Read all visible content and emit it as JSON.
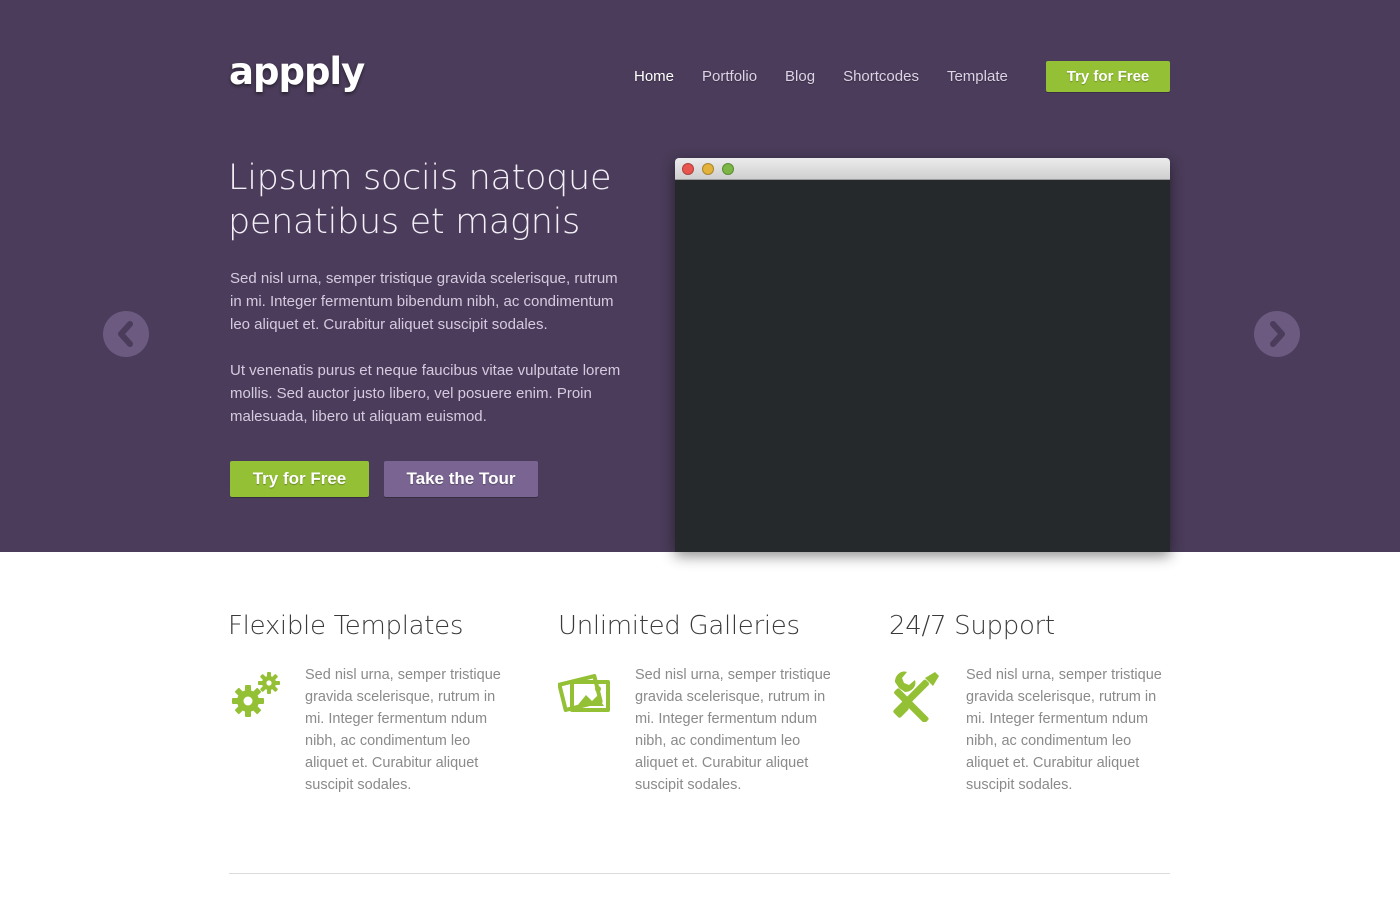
{
  "brand": {
    "logo": "appply"
  },
  "nav": {
    "items": [
      "Home",
      "Portfolio",
      "Blog",
      "Shortcodes",
      "Template"
    ],
    "cta": "Try for Free"
  },
  "hero": {
    "headline": "Lipsum sociis natoque penatibus et magnis",
    "paragraphs": [
      "Sed nisl urna, semper tristique gravida scelerisque, rutrum in mi. Integer fermentum bibendum nibh, ac condimentum leo aliquet et. Curabitur aliquet suscipit sodales.",
      "Ut venenatis purus et neque faucibus vitae vulputate lorem mollis. Sed auctor justo libero, vel posuere enim. Proin malesuada, libero ut aliquam euismod."
    ],
    "primary_button": "Try for Free",
    "secondary_button": "Take the Tour",
    "prev_icon": "chevron-left-icon",
    "next_icon": "chevron-right-icon"
  },
  "features": [
    {
      "title": "Flexible Templates",
      "icon": "gears-icon",
      "text": "Sed nisl urna, semper tristique gravida scelerisque, rutrum in mi. Integer fermentum ndum nibh, ac condimentum leo aliquet et. Curabitur aliquet suscipit sodales."
    },
    {
      "title": "Unlimited Galleries",
      "icon": "photos-icon",
      "text": "Sed nisl urna, semper tristique gravida scelerisque, rutrum in mi. Integer fermentum ndum nibh, ac condimentum leo aliquet et. Curabitur aliquet suscipit sodales."
    },
    {
      "title": "24/7 Support",
      "icon": "tools-icon",
      "text": "Sed nisl urna, semper tristique gravida scelerisque, rutrum in mi. Integer fermentum ndum nibh, ac condimentum leo aliquet et. Curabitur aliquet suscipit sodales."
    }
  ],
  "colors": {
    "hero_bg": "#4a3c5a",
    "accent_green": "#94c035",
    "secondary_purple": "#7a6592",
    "window_body": "#26292b"
  }
}
